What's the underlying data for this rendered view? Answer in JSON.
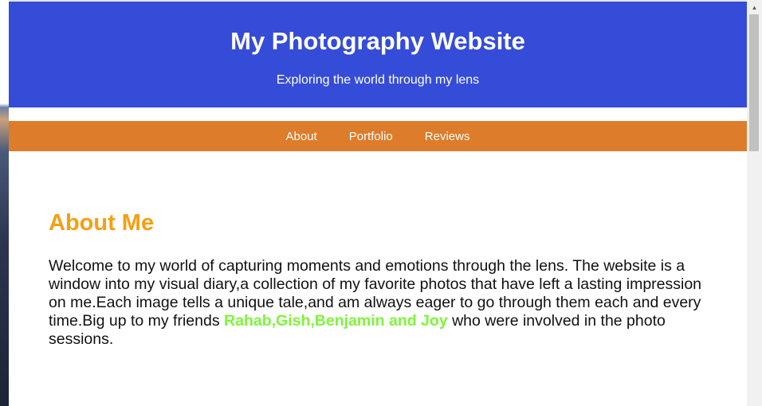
{
  "header": {
    "title": "My Photography Website",
    "subtitle": "Exploring the world through my lens"
  },
  "nav": {
    "items": [
      {
        "label": "About"
      },
      {
        "label": "Portfolio"
      },
      {
        "label": "Reviews"
      }
    ]
  },
  "about": {
    "heading": "About Me",
    "text_before": "Welcome to my world of capturing moments and emotions through the lens. The website is a window into my visual diary,a collection of my favorite photos that have left a lasting impression on me.Each image tells a unique tale,and am always eager to go through them each and every time.Big up to my friends ",
    "friends": "Rahab,Gish,Benjamin and Joy",
    "text_after": " who were involved in the photo sessions."
  },
  "colors": {
    "header_bg": "#354cd8",
    "nav_bg": "#dd7c2a",
    "heading_color": "#f59f12",
    "friends_color": "#7ef53a"
  },
  "scrollbar": {
    "up_icon": "chevron-up-icon"
  }
}
